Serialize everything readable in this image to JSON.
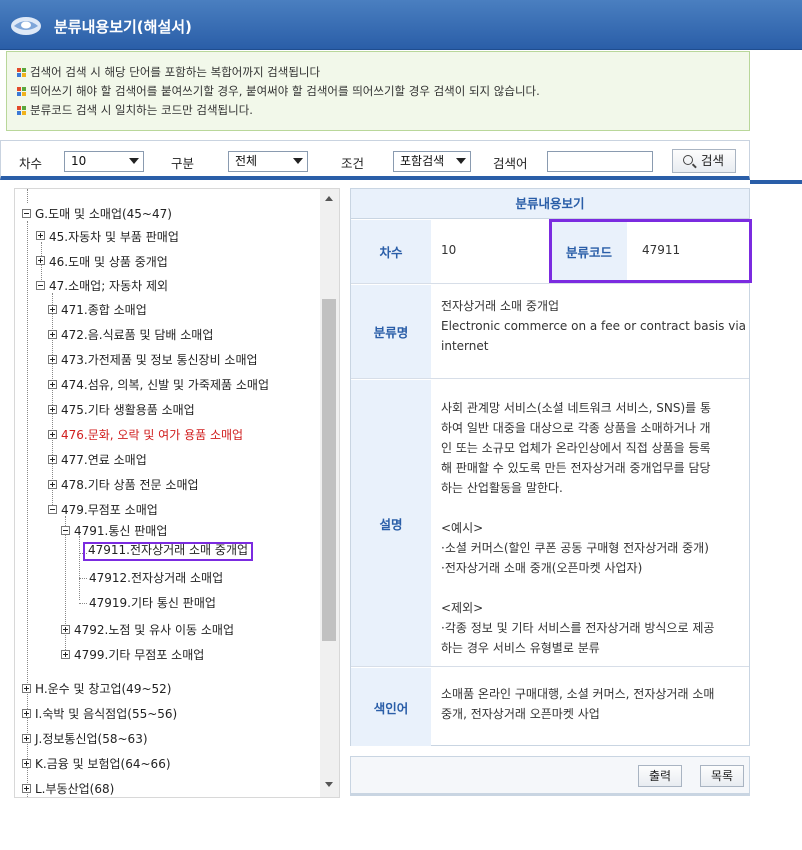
{
  "window": {
    "title": "분류내용보기(해설서)"
  },
  "notice": {
    "lines": [
      "검색어 검색 시 해당 단어를 포함하는 복합어까지 검색됩니다",
      "띄어쓰기 해야 할 검색어를 붙여쓰기할 경우, 붙여써야 할 검색어를 띄어쓰기할 경우 검색이 되지 않습니다.",
      "분류코드 검색 시 일치하는 코드만 검색됩니다."
    ]
  },
  "search": {
    "version_label": "차수",
    "version_value": "10",
    "category_label": "구분",
    "category_value": "전체",
    "condition_label": "조건",
    "condition_value": "포함검색",
    "keyword_label": "검색어",
    "keyword_value": "",
    "search_button": "검색"
  },
  "tree": {
    "items": [
      {
        "label": "G.도매 및 소매업(45~47)"
      },
      {
        "label": "45.자동차 및 부품 판매업"
      },
      {
        "label": "46.도매 및 상품 중개업"
      },
      {
        "label": "47.소매업; 자동차 제외"
      },
      {
        "label": "471.종합 소매업"
      },
      {
        "label": "472.음.식료품 및 담배 소매업"
      },
      {
        "label": "473.가전제품 및 정보 통신장비 소매업"
      },
      {
        "label": "474.섬유, 의복, 신발 및 가죽제품 소매업"
      },
      {
        "label": "475.기타 생활용품 소매업"
      },
      {
        "label": "476.문화, 오락 및 여가 용품 소매업"
      },
      {
        "label": "477.연료 소매업"
      },
      {
        "label": "478.기타 상품 전문 소매업"
      },
      {
        "label": "479.무점포 소매업"
      },
      {
        "label": "4791.통신 판매업"
      },
      {
        "label": "47911.전자상거래 소매 중개업"
      },
      {
        "label": "47912.전자상거래 소매업"
      },
      {
        "label": "47919.기타 통신 판매업"
      },
      {
        "label": "4792.노점 및 유사 이동 소매업"
      },
      {
        "label": "4799.기타 무점포 소매업"
      },
      {
        "label": "H.운수 및 창고업(49~52)"
      },
      {
        "label": "I.숙박 및 음식점업(55~56)"
      },
      {
        "label": "J.정보통신업(58~63)"
      },
      {
        "label": "K.금융 및 보험업(64~66)"
      },
      {
        "label": "L.부동산업(68)"
      }
    ]
  },
  "detail": {
    "heading": "분류내용보기",
    "version_label": "차수",
    "version_value": "10",
    "code_label": "분류코드",
    "code_value": "47911",
    "name_label": "분류명",
    "name_ko": "전자상거래 소매 중개업",
    "name_en_1": "Electronic commerce on a fee or contract basis via",
    "name_en_2": "internet",
    "desc_label": "설명",
    "desc_lines": [
      "사회 관계망 서비스(소셜 네트워크 서비스, SNS)를 통",
      "하여 일반 대중을 대상으로 각종 상품을 소매하거나 개",
      "인 또는 소규모 업체가 온라인상에서 직접 상품을 등록",
      "해 판매할 수 있도록 만든 전자상거래 중개업무를 담당",
      "하는 산업활동을 말한다.",
      "",
      "<예시>",
      "·소셜 커머스(할인 쿠폰 공동 구매형 전자상거래 중개)",
      "·전자상거래 소매 중개(오픈마켓 사업자)",
      "",
      "<제외>",
      "·각종 정보 및 기타 서비스를 전자상거래 방식으로 제공",
      "하는 경우 서비스 유형별로 분류"
    ],
    "index_label": "색인어",
    "index_lines": [
      "소매품 온라인 구매대행, 소셜 커머스, 전자상거래 소매",
      "중개, 전자상거래 오픈마켓 사업"
    ]
  },
  "buttons": {
    "print": "출력",
    "list": "목록"
  },
  "colors": {
    "brand": "#2a5ea8",
    "highlight": "#7b2be0",
    "red_item": "#d01e1e"
  }
}
